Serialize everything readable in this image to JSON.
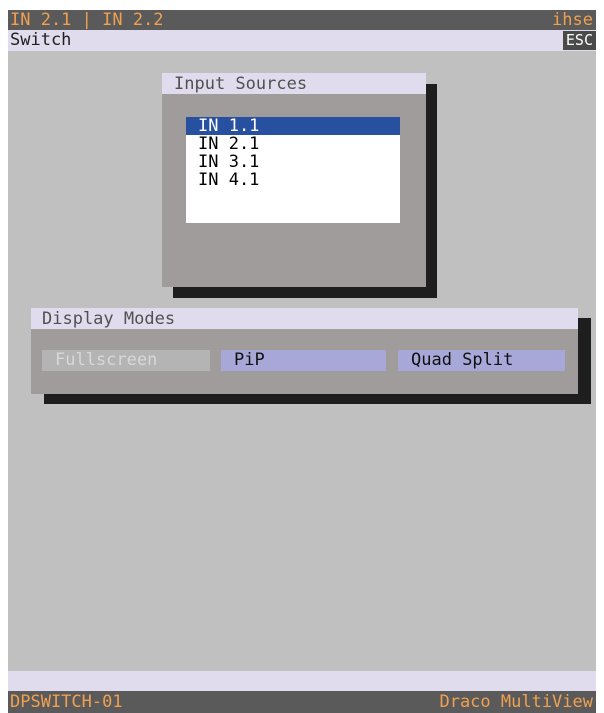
{
  "titlebar": {
    "left": "IN 2.1 | IN 2.2",
    "right": "ihse"
  },
  "menubar": {
    "left": "Switch",
    "esc_label": "ESC"
  },
  "input_sources": {
    "title": "Input Sources",
    "items": [
      {
        "label": "IN 1.1",
        "selected": true
      },
      {
        "label": "IN 2.1",
        "selected": false
      },
      {
        "label": "IN 3.1",
        "selected": false
      },
      {
        "label": "IN 4.1",
        "selected": false
      }
    ]
  },
  "display_modes": {
    "title": "Display Modes",
    "buttons": [
      {
        "label": "Fullscreen",
        "enabled": false
      },
      {
        "label": "PiP",
        "enabled": true
      },
      {
        "label": "Quad Split",
        "enabled": true
      }
    ]
  },
  "statusbar": {
    "left": "DPSWITCH-01",
    "right": "Draco MultiView"
  },
  "colors": {
    "background": "#c0c0c0",
    "bar_dark": "#5a5a5a",
    "bar_text": "#f0a050",
    "bar_light": "#e0dcee",
    "panel": "#a09c9c",
    "shadow": "#1e1e1e",
    "selection": "#2850a0",
    "button_enabled": "#a8a8d8",
    "button_disabled": "#b4b4b4"
  }
}
